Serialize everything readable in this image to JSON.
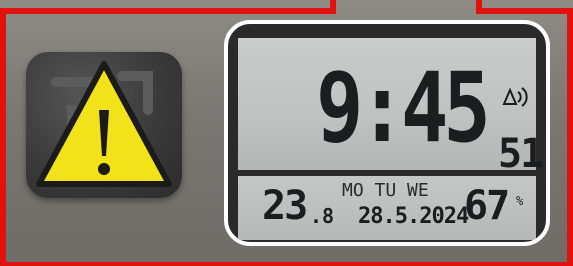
{
  "clock": {
    "time": "9:45",
    "seconds": "51",
    "temperature": "23",
    "temperature_decimal": ".8",
    "weekday": "MO TU WE",
    "date": "28.5.2024",
    "humidity": "67",
    "humidity_unit": "%"
  },
  "colors": {
    "frame": "#e1110d",
    "warning_fill": "#f2e21a",
    "tile": "#3a3a3a"
  },
  "icons": {
    "warning": "warning-triangle-icon",
    "radio": "radio-signal-icon"
  }
}
